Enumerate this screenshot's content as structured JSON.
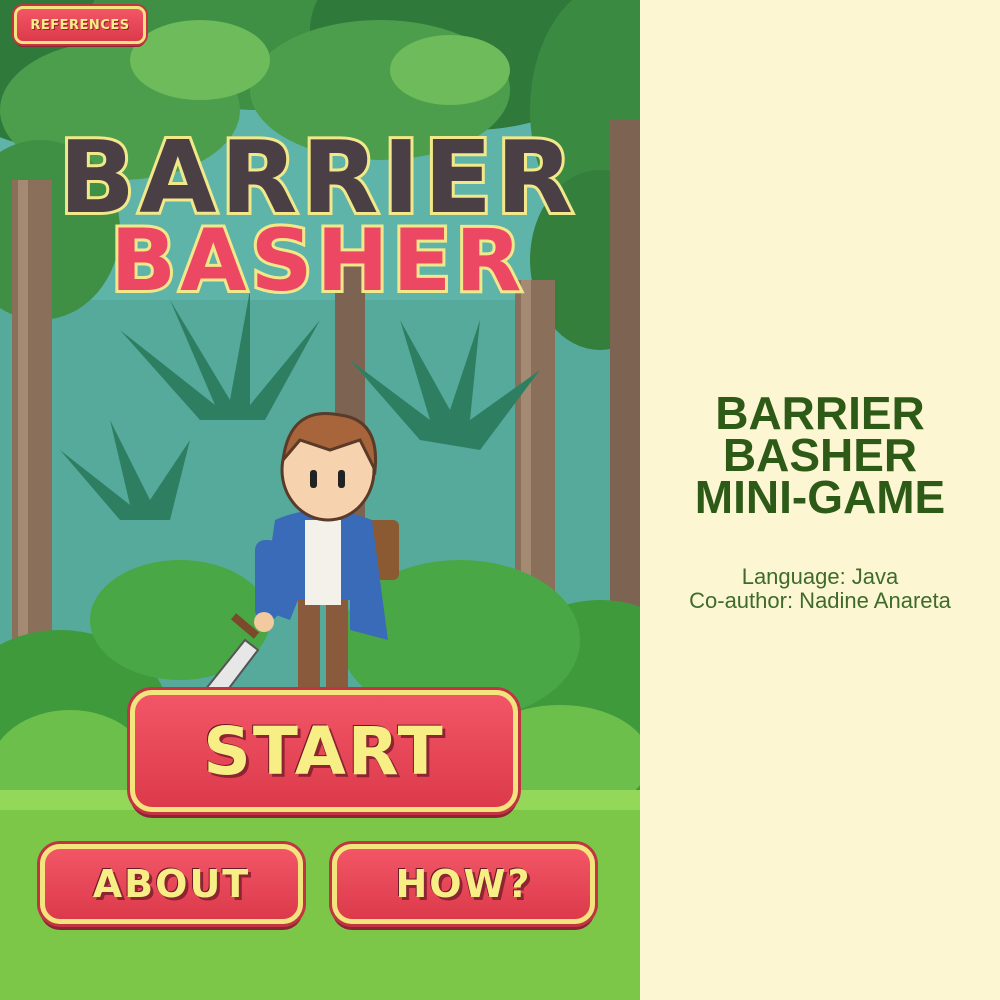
{
  "game": {
    "references_label": "REFERENCES",
    "logo": {
      "line1": "BARRIER",
      "line2": "BASHER"
    },
    "start_label": "START",
    "about_label": "ABOUT",
    "how_label": "HOW?"
  },
  "info": {
    "title_line1": "BARRIER",
    "title_line2": "BASHER",
    "title_line3": "MINI-GAME",
    "language": "Language: Java",
    "coauthor": "Co-author: Nadine Anareta"
  },
  "colors": {
    "panel_bg": "#fdf6d3",
    "title_green": "#2d5a17",
    "button_red": "#e5465a",
    "button_text_yellow": "#f7ef86",
    "logo_dark": "#4a3f45",
    "logo_pink": "#ec4863"
  }
}
